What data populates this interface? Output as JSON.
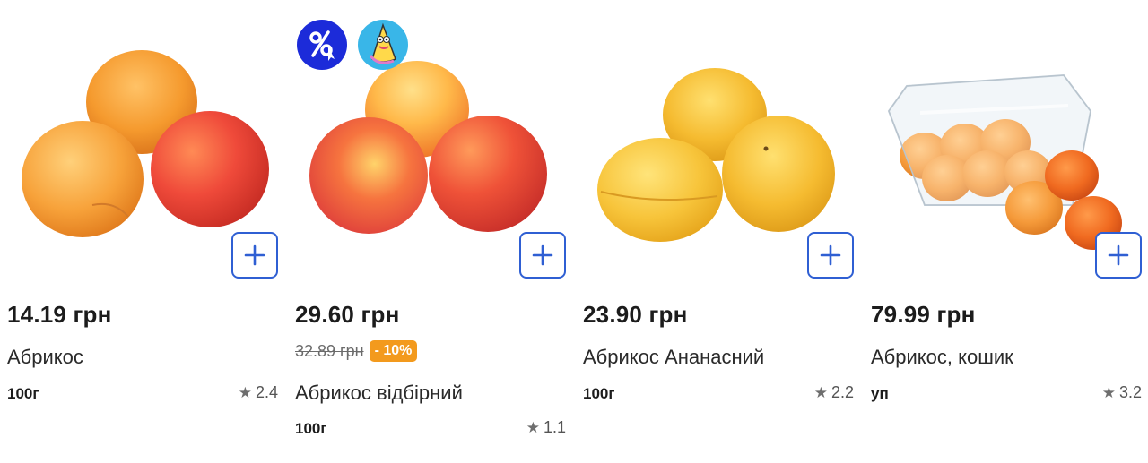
{
  "products": [
    {
      "price": "14.19 грн",
      "name": "Абрикос",
      "unit": "100г",
      "rating": "2.4",
      "image": "apricots-three-orange-red"
    },
    {
      "price": "29.60 грн",
      "old_price": "32.89 грн",
      "discount": "- 10%",
      "name": "Абрикос відбірний",
      "unit": "100г",
      "rating": "1.1",
      "image": "apricots-select-red-yellow",
      "badges": [
        "sale-percent-icon",
        "mascot-icon"
      ]
    },
    {
      "price": "23.90 грн",
      "name": "Абрикос Ананасний",
      "unit": "100г",
      "rating": "2.2",
      "image": "apricots-pineapple-yellow"
    },
    {
      "price": "79.99 грн",
      "name": "Абрикос, кошик",
      "unit": "уп",
      "rating": "3.2",
      "image": "apricots-in-plastic-basket"
    }
  ],
  "colors": {
    "accent": "#2f5fd3",
    "discount": "#f39a1d",
    "sale_badge": "#1c2bd9",
    "mascot_badge": "#39b6e8"
  }
}
